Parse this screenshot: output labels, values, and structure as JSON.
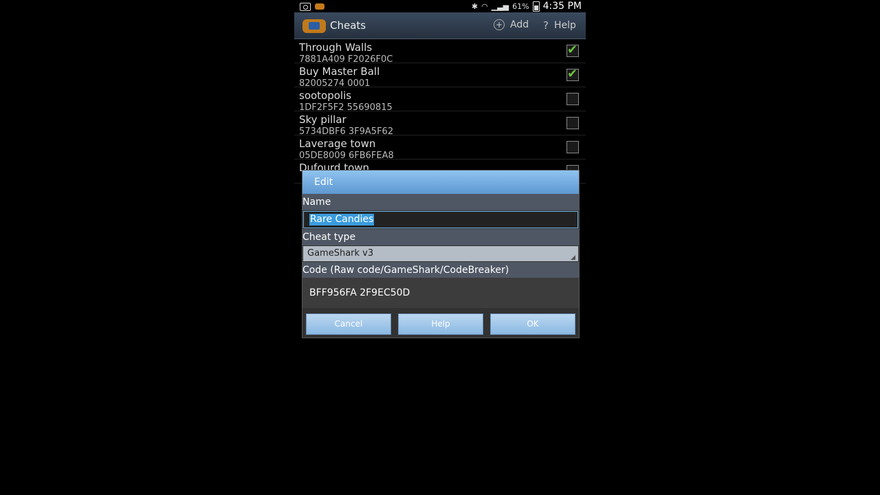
{
  "status_bar": {
    "battery": "61%",
    "time": "4:35 PM"
  },
  "action_bar": {
    "title": "Cheats",
    "add_label": "Add",
    "help_label": "Help"
  },
  "cheats": [
    {
      "name": "Through Walls",
      "code": "7881A409 F2026F0C",
      "checked": true
    },
    {
      "name": "Buy Master Ball",
      "code": "82005274 0001",
      "checked": true
    },
    {
      "name": "sootopolis",
      "code": "1DF2F5F2 55690815",
      "checked": false
    },
    {
      "name": "Sky pillar",
      "code": "5734DBF6 3F9A5F62",
      "checked": false
    },
    {
      "name": "Laverage town",
      "code": "05DE8009 6FB6FEA8",
      "checked": false
    },
    {
      "name": "Dufourd town",
      "code": "",
      "checked": false
    }
  ],
  "dialog": {
    "title": "Edit",
    "name_label": "Name",
    "name_value": "Rare Candies",
    "cheat_type_label": "Cheat type",
    "cheat_type_value": "GameShark v3",
    "code_label": "Code (Raw code/GameShark/CodeBreaker)",
    "code_value": "BFF956FA 2F9EC50D",
    "cancel_label": "Cancel",
    "help_label": "Help",
    "ok_label": "OK"
  },
  "colors": {
    "accent": "#5e98d1",
    "check": "#6ac23a",
    "selection": "#3a9cdd"
  }
}
